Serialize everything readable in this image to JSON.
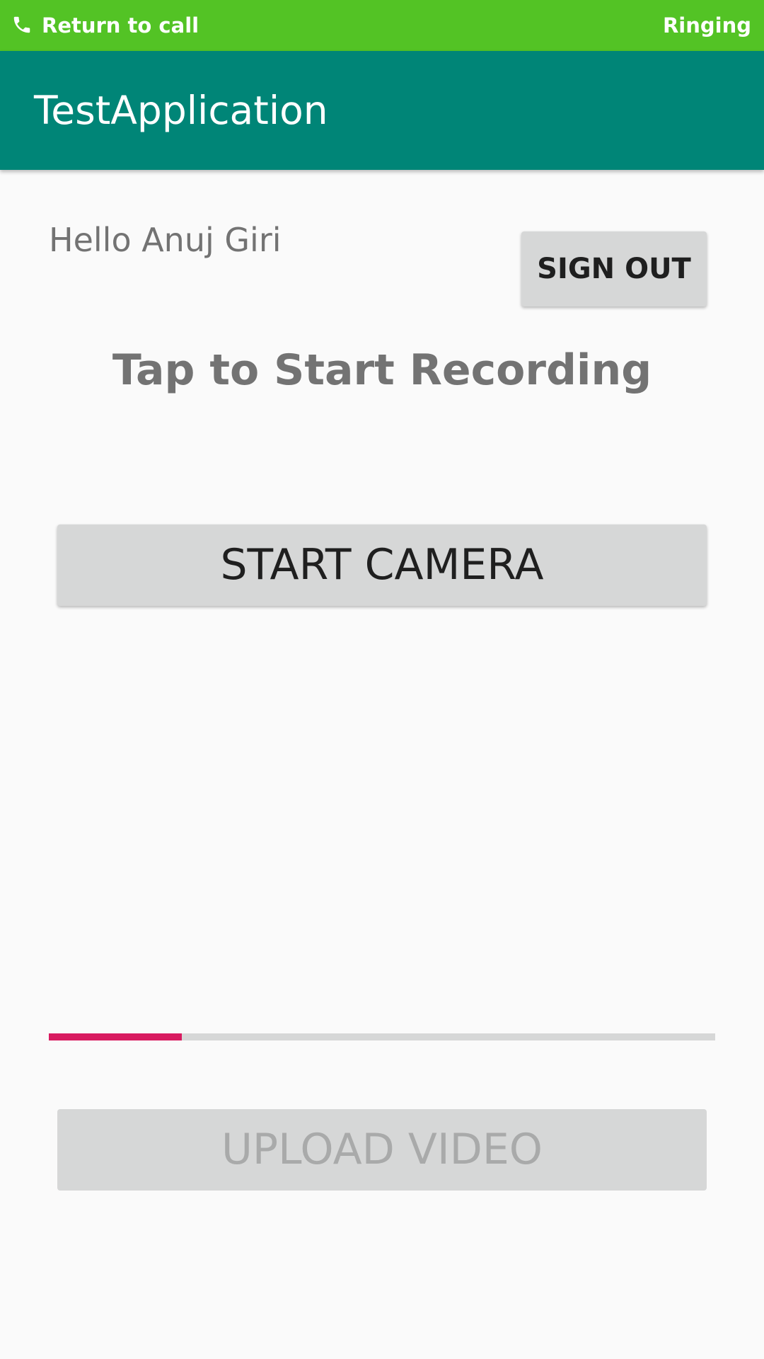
{
  "call_bar": {
    "label": "Return to call",
    "status": "Ringing",
    "icon": "phone-icon",
    "color": "#53c325"
  },
  "app_bar": {
    "title": "TestApplication",
    "color": "#008577"
  },
  "main": {
    "greeting": "Hello Anuj Giri",
    "sign_out_label": "SIGN OUT",
    "headline": "Tap to Start Recording",
    "start_camera_label": "START CAMERA",
    "progress": {
      "value": 0.2,
      "fill_color": "#d81b60",
      "track_color": "#d6d7d7"
    },
    "upload_video_label": "UPLOAD VIDEO",
    "upload_enabled": false
  }
}
